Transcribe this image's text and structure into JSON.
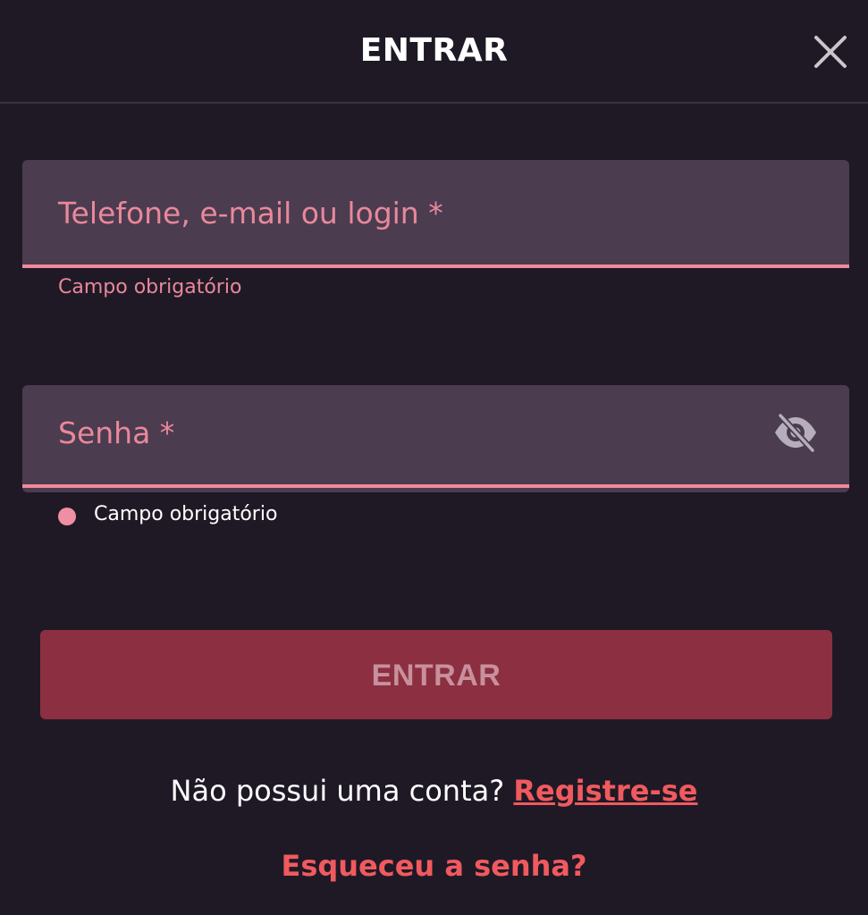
{
  "header": {
    "title": "ENTRAR",
    "close_icon": "close-icon"
  },
  "login_field": {
    "label": "Telefone, e-mail ou login *",
    "value": "",
    "helper": "Campo obrigatório"
  },
  "password_field": {
    "label": "Senha *",
    "value": "",
    "helper": "Campo obrigatório",
    "toggle_icon": "eye-off-icon"
  },
  "submit": {
    "label": "ENTRAR"
  },
  "register": {
    "prompt": "Não possui uma conta?",
    "link": "Registre-se"
  },
  "forgot": {
    "link": "Esqueceu a senha?"
  },
  "colors": {
    "background": "#1f1926",
    "field_background": "#4b3c50",
    "accent_pink": "#ef8a9a",
    "button": "#8c2f41",
    "link_red": "#f05a5e"
  }
}
